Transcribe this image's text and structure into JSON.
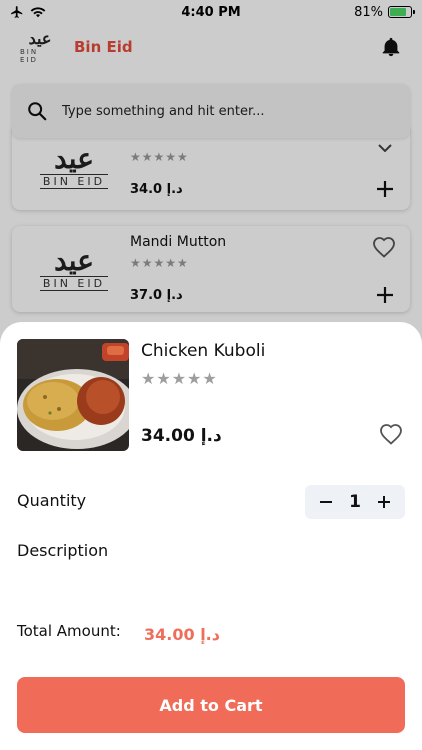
{
  "status_bar": {
    "time": "4:40 PM",
    "battery": "81%",
    "battery_level": 0.81
  },
  "header": {
    "logo_mark": "عيد",
    "logo_text": "BIN EID",
    "brand": "Bin Eid",
    "notification_icon": "bell-icon"
  },
  "search": {
    "placeholder": "Type something and hit enter...",
    "icon": "search-icon"
  },
  "background_items": [
    {
      "name": "",
      "logo_mark": "عيد",
      "logo_text": "BIN EID",
      "stars": "★★★★★",
      "price": "34.0 د.إ"
    },
    {
      "name": "Mandi Mutton",
      "logo_mark": "عيد",
      "logo_text": "BIN EID",
      "stars": "★★★★★",
      "price": "37.0 د.إ"
    }
  ],
  "detail": {
    "name": "Chicken Kuboli",
    "stars": "★★★★★",
    "rating": 0,
    "price": "34.00 د.إ",
    "quantity_label": "Quantity",
    "quantity": "1",
    "description_label": "Description",
    "total_label": "Total Amount:",
    "total_value": "34.00 د.إ",
    "add_button": "Add to Cart"
  },
  "colors": {
    "accent": "#f06b58",
    "brand": "#e84c3d",
    "stepper_bg": "#eef2f7"
  }
}
